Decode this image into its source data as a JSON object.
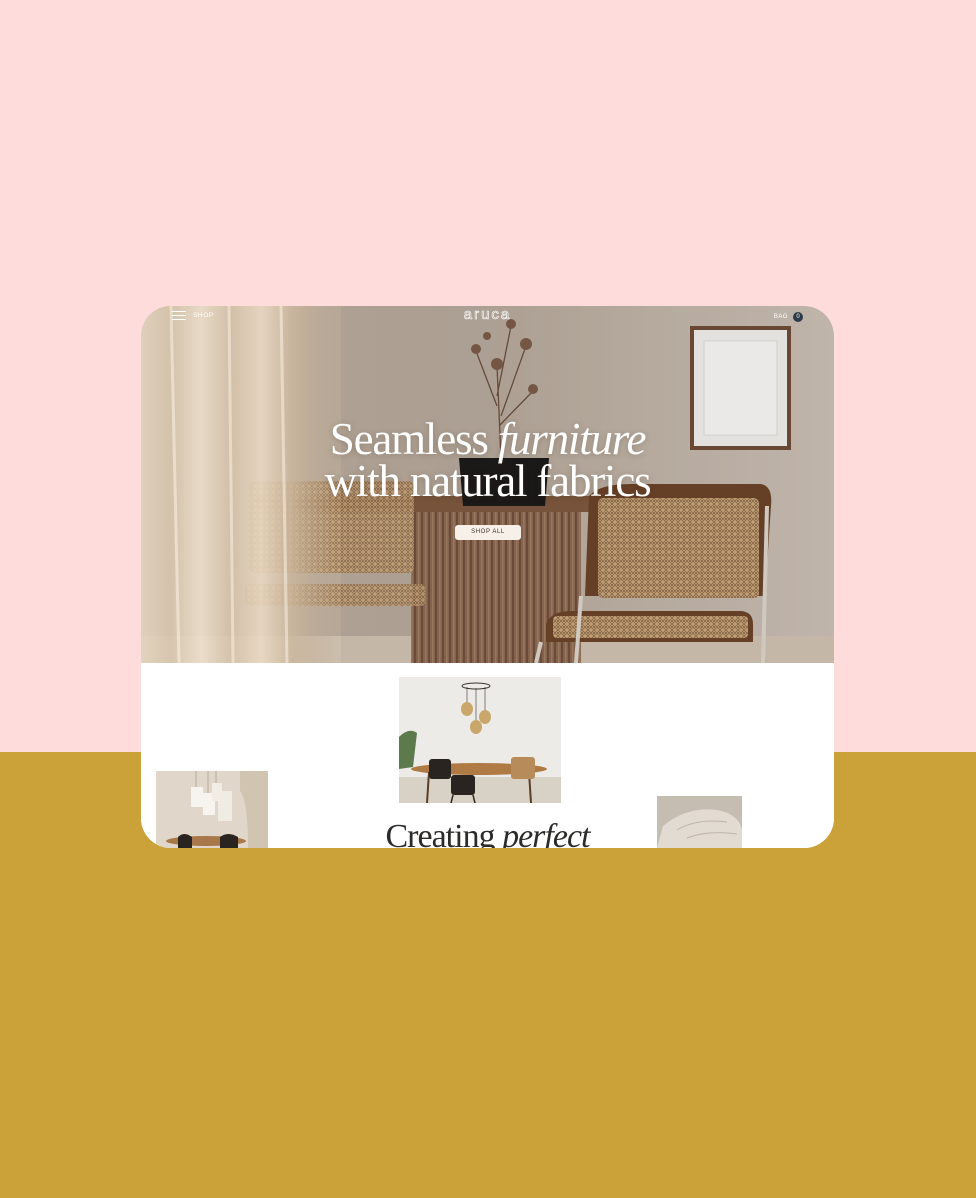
{
  "colors": {
    "background_top": "#ffdcdc",
    "background_bottom": "#cba239",
    "hero_text": "#ffffff",
    "button_bg": "#f6f0e8",
    "bag_badge": "#2f3a48",
    "heading_dark": "#2c2b2a"
  },
  "nav": {
    "menu_icon": "hamburger-icon",
    "menu_label": "SHOP",
    "logo": "aruca",
    "bag_label": "BAG",
    "bag_count": "0"
  },
  "hero": {
    "headline_line1_regular": "Seamless ",
    "headline_line1_italic": "furniture",
    "headline_line2": "with natural fabrics",
    "button_label": "SHOP ALL"
  },
  "section": {
    "heading_regular": "Creating ",
    "heading_italic": "perfect"
  }
}
